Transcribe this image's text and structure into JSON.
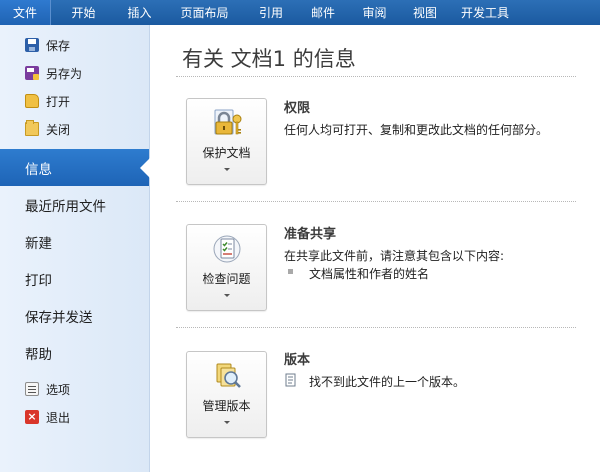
{
  "ribbon": {
    "tabs": [
      "文件",
      "开始",
      "插入",
      "页面布局",
      "引用",
      "邮件",
      "审阅",
      "视图",
      "开发工具"
    ]
  },
  "nav": {
    "small_top": [
      {
        "label": "保存",
        "icon": "save-icon"
      },
      {
        "label": "另存为",
        "icon": "save-as-icon"
      },
      {
        "label": "打开",
        "icon": "open-folder-icon"
      },
      {
        "label": "关闭",
        "icon": "close-folder-icon"
      }
    ],
    "big": [
      "信息",
      "最近所用文件",
      "新建",
      "打印",
      "保存并发送",
      "帮助"
    ],
    "small_bottom": [
      {
        "label": "选项",
        "icon": "options-icon"
      },
      {
        "label": "退出",
        "icon": "exit-icon"
      }
    ],
    "selected": "信息"
  },
  "main": {
    "title": "有关 文档1 的信息",
    "sections": [
      {
        "button_label": "保护文档",
        "icon": "lock-key-icon",
        "heading": "权限",
        "description": "任何人均可打开、复制和更改此文档的任何部分。"
      },
      {
        "button_label": "检查问题",
        "icon": "checklist-icon",
        "heading": "准备共享",
        "description": "在共享此文件前，请注意其包含以下内容:",
        "bullet": "文档属性和作者的姓名"
      },
      {
        "button_label": "管理版本",
        "icon": "versions-magnifier-icon",
        "heading": "版本",
        "version_text": "找不到此文件的上一个版本。"
      }
    ]
  },
  "colors": {
    "ribbon_blue": "#2c6fb6",
    "selected_blue": "#2e7ccf",
    "nav_bg": "#dbe8f7"
  }
}
